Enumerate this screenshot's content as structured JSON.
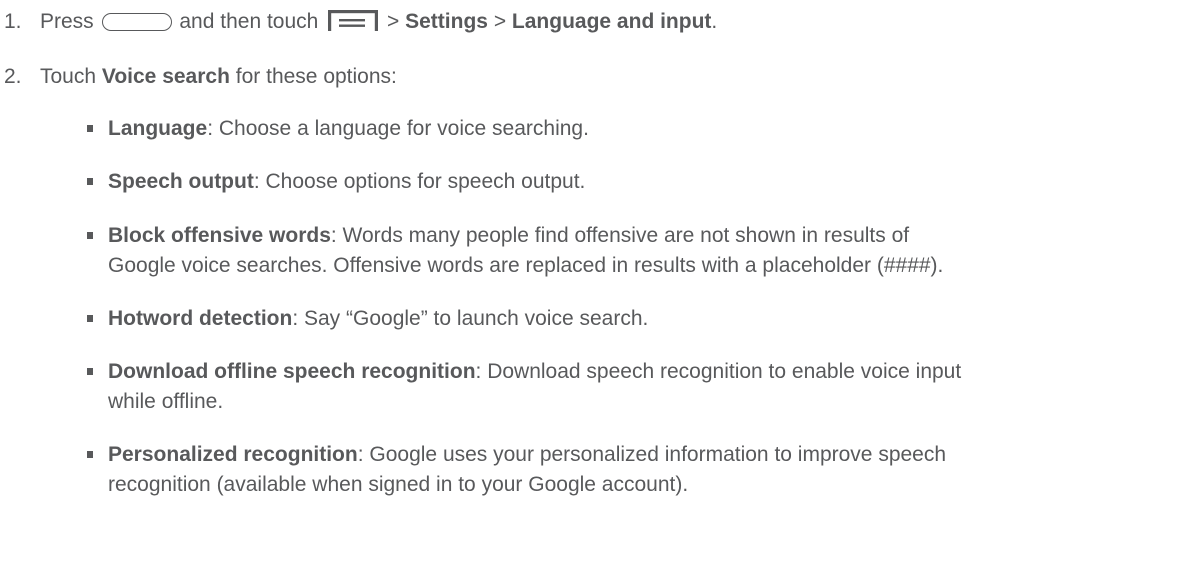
{
  "steps": [
    {
      "num": "1.",
      "press": "Press",
      "then_touch": "and then touch",
      "sep1": ">",
      "settings": "Settings",
      "sep2": ">",
      "language_input": "Language and input",
      "end": "."
    },
    {
      "num": "2.",
      "touch": "Touch",
      "voice_search": "Voice search",
      "rest": "for these options:"
    }
  ],
  "icons": {
    "home": "home-button-icon",
    "menu": "menu-icon"
  },
  "options": [
    {
      "term": "Language",
      "desc": ": Choose a language for voice searching."
    },
    {
      "term": "Speech output",
      "desc": ": Choose options for speech output."
    },
    {
      "term": "Block offensive words",
      "desc": ": Words many people find offensive are not shown in results of",
      "desc2": "Google voice searches. Offensive words are replaced in results with a placeholder (####)."
    },
    {
      "term": "Hotword detection",
      "desc": ": Say “Google” to launch voice search."
    },
    {
      "term": "Download offline speech recognition",
      "desc": ": Download speech recognition to enable voice input",
      "desc2": "while offline."
    },
    {
      "term": "Personalized recognition",
      "desc": ": Google uses your personalized information to improve speech",
      "desc2": "recognition (available when signed in to your Google account)."
    }
  ],
  "colors": {
    "text": "#58595b",
    "background": "#ffffff"
  }
}
